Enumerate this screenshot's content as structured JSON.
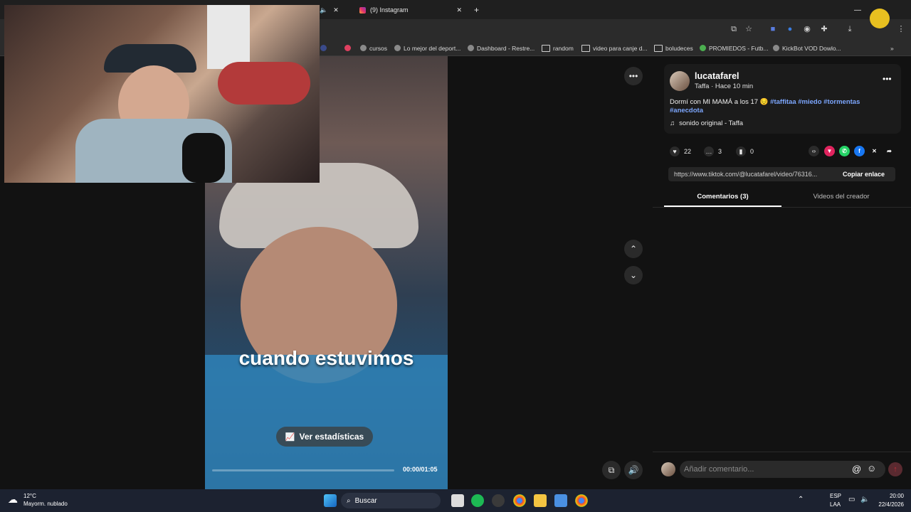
{
  "browser": {
    "tabs": [
      {
        "label": "(9) Instagram"
      }
    ],
    "new_tab": "+",
    "bookmarks": [
      {
        "label": "cursos"
      },
      {
        "label": "Lo mejor del deport..."
      },
      {
        "label": "Dashboard - Restre..."
      },
      {
        "label": "random"
      },
      {
        "label": "video para canje d..."
      },
      {
        "label": "boludeces"
      },
      {
        "label": "PROMIEDOS - Futb..."
      },
      {
        "label": "KickBot VOD Dowlo..."
      }
    ]
  },
  "search": {
    "text": "o"
  },
  "video": {
    "caption": "cuando estuvimos",
    "stats_button": "Ver estadísticas",
    "time": "00:00/01:05",
    "progress_fraction": 0.0
  },
  "post": {
    "username": "lucatafarel",
    "meta": "Taffa · Hace 10 min",
    "description_text": "Dormí con MI MAMÁ a los 17 😔 ",
    "hashtags": [
      "#taffitaa",
      "#miedo",
      "#tormentas",
      "#anecdota"
    ],
    "sound": "sonido original - Taffa",
    "likes": "22",
    "comments": "3",
    "saves": "0",
    "link": "https://www.tiktok.com/@lucatafarel/video/76316...",
    "copy_link": "Copiar enlace",
    "tab_comments": "Comentarios (3)",
    "tab_creator": "Videos del creador",
    "comment_placeholder": "Añadir comentario..."
  },
  "taskbar": {
    "weather_temp": "12°C",
    "weather_desc": "Mayorm. nublado",
    "search_label": "Buscar",
    "lang_top": "ESP",
    "lang_bottom": "LAA",
    "clock_time": "20:00",
    "clock_date": "22/4/2026"
  },
  "colors": {
    "accent_tag": "#7da7ff",
    "send_button": "#c0303a"
  }
}
